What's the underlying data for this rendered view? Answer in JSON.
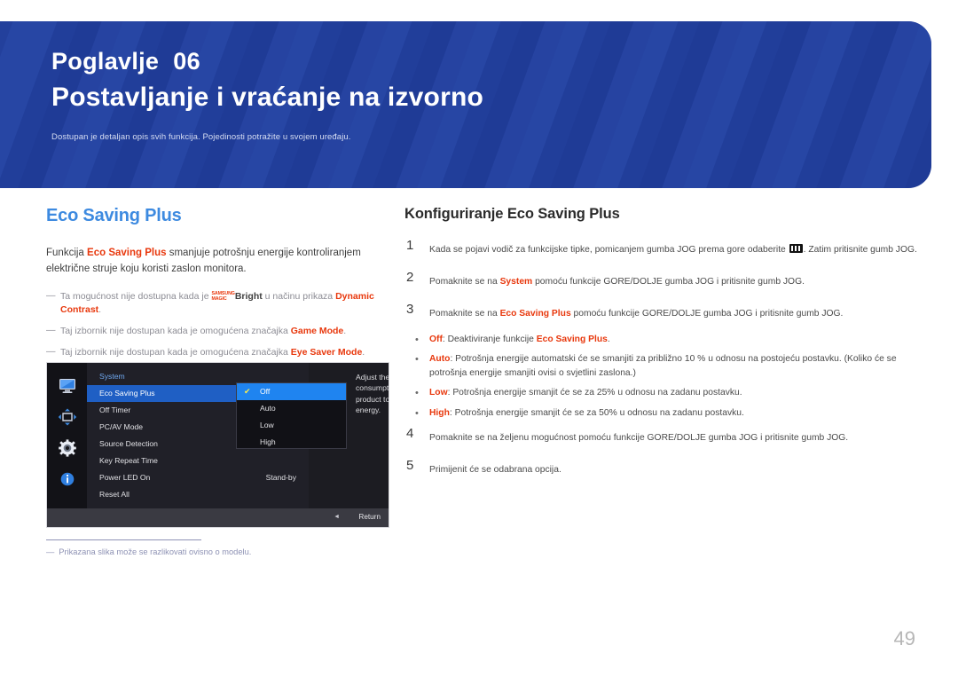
{
  "banner": {
    "chapter_label": "Poglavlje",
    "chapter_number": "06",
    "title": "Postavljanje i vraćanje na izvorno",
    "subtitle": "Dostupan je detaljan opis svih funkcija. Pojedinosti potražite u svojem uređaju.",
    "bg_color": "#23409c"
  },
  "left": {
    "heading": "Eco Saving Plus",
    "heading_color": "#3d8ae0",
    "paragraph": {
      "p1": "Funkcija ",
      "term1": "Eco Saving Plus",
      "p2": " smanjuje potrošnju energije kontroliranjem električne struje koju koristi zaslon monitora."
    },
    "notes": [
      {
        "dash": "―",
        "pre": "Ta mogućnost nije dostupna kada je ",
        "magic_top": "SAMSUNG",
        "magic_bottom": "MAGIC",
        "bright": "Bright",
        "mid": " u načinu prikaza ",
        "term": "Dynamic Contrast",
        "post": "."
      },
      {
        "dash": "―",
        "pre": "Taj izbornik nije dostupan kada je omogućena značajka ",
        "term": "Game Mode",
        "post": "."
      },
      {
        "dash": "―",
        "pre": "Taj izbornik nije dostupan kada je omogućena značajka ",
        "term": "Eye Saver Mode",
        "post": "."
      }
    ],
    "footnote": {
      "dash": "―",
      "text": "Prikazana slika može se razlikovati ovisno o modelu."
    }
  },
  "osd": {
    "rail_icons": [
      "monitor-icon",
      "move-arrows-icon",
      "gear-icon",
      "info-icon"
    ],
    "section_title": "System",
    "menu_items": [
      {
        "label": "Eco Saving Plus",
        "value": "",
        "selected": true
      },
      {
        "label": "Off Timer",
        "value": "",
        "selected": false
      },
      {
        "label": "PC/AV Mode",
        "value": "",
        "selected": false
      },
      {
        "label": "Source Detection",
        "value": "",
        "selected": false
      },
      {
        "label": "Key Repeat Time",
        "value": "",
        "selected": false
      },
      {
        "label": "Power LED On",
        "value": "Stand-by",
        "selected": false
      },
      {
        "label": "Reset All",
        "value": "",
        "selected": false
      }
    ],
    "dropdown_options": [
      {
        "label": "Off",
        "selected": true
      },
      {
        "label": "Auto",
        "selected": false
      },
      {
        "label": "Low",
        "selected": false
      },
      {
        "label": "High",
        "selected": false
      }
    ],
    "description": "Adjust the power consumption of the product to save energy.",
    "footer_return": "Return",
    "footer_arrow": "◄",
    "check_glyph": "✔",
    "highlight_color": "#1f84f0"
  },
  "right": {
    "heading": "Konfiguriranje Eco Saving Plus",
    "steps": [
      {
        "number": "1",
        "pre": "Kada se pojavi vodič za funkcijske tipke, pomicanjem gumba JOG prema gore odaberite ",
        "icon": "menu-bars-icon",
        "post": ". Zatim pritisnite gumb JOG."
      },
      {
        "number": "2",
        "pre": "Pomaknite se na ",
        "term": "System",
        "post": " pomoću funkcije GORE/DOLJE gumba JOG i pritisnite gumb JOG."
      },
      {
        "number": "3",
        "pre": "Pomaknite se na ",
        "term": "Eco Saving Plus",
        "post": " pomoću funkcije GORE/DOLJE gumba JOG i pritisnite gumb JOG."
      }
    ],
    "bullets": [
      {
        "dot": "•",
        "term": "Off",
        "pre": ": Deaktiviranje funkcije ",
        "term2": "Eco Saving Plus",
        "post": "."
      },
      {
        "dot": "•",
        "term": "Auto",
        "post": ": Potrošnja energije automatski će se smanjiti za približno 10 % u odnosu na postojeću postavku. (Koliko će se potrošnja energije smanjiti ovisi o svjetlini zaslona.)"
      },
      {
        "dot": "•",
        "term": "Low",
        "post": ": Potrošnja energije smanjit će se za 25% u odnosu na zadanu postavku."
      },
      {
        "dot": "•",
        "term": "High",
        "post": ": Potrošnja energije smanjit će se za 50% u odnosu na zadanu postavku."
      }
    ],
    "steps_after": [
      {
        "number": "4",
        "text": "Pomaknite se na željenu mogućnost pomoću funkcije GORE/DOLJE gumba JOG i pritisnite gumb JOG."
      },
      {
        "number": "5",
        "text": "Primijenit će se odabrana opcija."
      }
    ]
  },
  "page_number": "49"
}
